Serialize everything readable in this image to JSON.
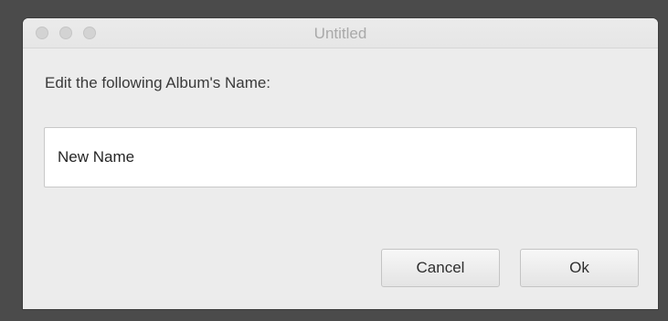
{
  "window": {
    "title": "Untitled"
  },
  "dialog": {
    "prompt": "Edit the following Album's Name:",
    "name_value": "New Name",
    "cancel_label": "Cancel",
    "ok_label": "Ok"
  },
  "icons": {
    "close": "window-close-icon",
    "minimize": "window-minimize-icon",
    "zoom": "window-zoom-icon"
  },
  "colors": {
    "window_bg": "#ececec",
    "traffic_light_inactive": "#d3d3d3",
    "title_text": "#a9a9a9",
    "desktop_bg": "#4b4b4b"
  }
}
